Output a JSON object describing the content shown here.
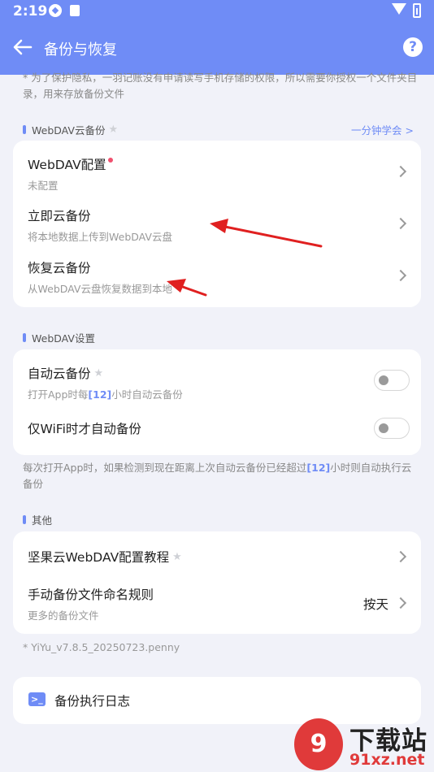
{
  "status_bar": {
    "time": "2:19"
  },
  "header": {
    "title": "备份与恢复",
    "help_glyph": "?"
  },
  "notice": "* 为了保护隐私，一羽记账没有申请读写手机存储的权限，所以需要你授权一个文件夹目录，用来存放备份文件",
  "sections": {
    "webdav_backup": {
      "title": "WebDAV云备份",
      "link": "一分钟学会 >",
      "rows": [
        {
          "title": "WebDAV配置",
          "subtitle": "未配置"
        },
        {
          "title": "立即云备份",
          "subtitle": "将本地数据上传到WebDAV云盘"
        },
        {
          "title": "恢复云备份",
          "subtitle": "从WebDAV云盘恢复数据到本地"
        }
      ]
    },
    "webdav_settings": {
      "title": "WebDAV设置",
      "auto_backup": {
        "title": "自动云备份",
        "sub_prefix": "打开App时每",
        "sub_value": "[12]",
        "sub_suffix": "小时自动云备份",
        "enabled": false
      },
      "wifi_only": {
        "title": "仅WiFi时才自动备份",
        "enabled": false
      },
      "hint_prefix": "每次打开App时，如果检测到现在距离上次自动云备份已经超过",
      "hint_value": "[12]",
      "hint_suffix": "小时则自动执行云备份"
    },
    "others": {
      "title": "其他",
      "rows": [
        {
          "title": "坚果云WebDAV配置教程"
        },
        {
          "title": "手动备份文件命名规则",
          "subtitle": "更多的备份文件",
          "value": "按天"
        }
      ]
    }
  },
  "version": "* YiYu_v7.8.5_20250723.penny",
  "log": {
    "title": "备份执行日志",
    "icon_glyph": ">_"
  },
  "watermark": {
    "icon_text": "9",
    "text": "下载站",
    "url": "91xz.net"
  },
  "colors": {
    "accent": "#6f8cf6",
    "background": "#f1f2f9",
    "annotation_arrow": "#e02020"
  }
}
